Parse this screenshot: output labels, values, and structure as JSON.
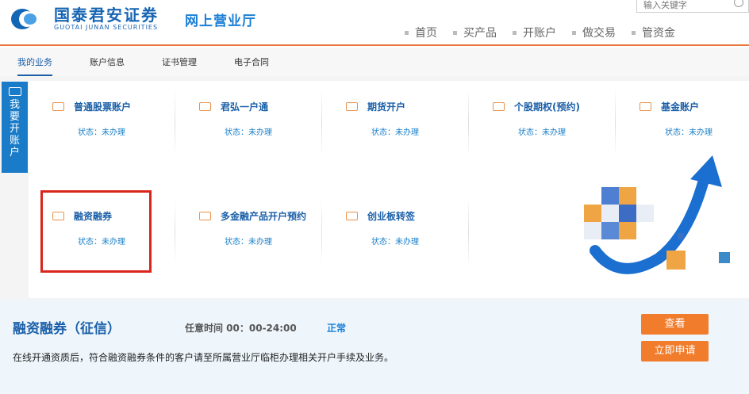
{
  "brand": {
    "name_cn": "国泰君安证券",
    "name_en": "GUOTAI JUNAN SECURITIES",
    "hall": "网上营业厅"
  },
  "search": {
    "placeholder": "输入关键字"
  },
  "topnav": [
    {
      "label": "首页"
    },
    {
      "label": "买产品"
    },
    {
      "label": "开账户"
    },
    {
      "label": "做交易"
    },
    {
      "label": "管资金"
    }
  ],
  "subnav": [
    {
      "label": "我的业务",
      "active": true
    },
    {
      "label": "账户信息",
      "active": false
    },
    {
      "label": "证书管理",
      "active": false
    },
    {
      "label": "电子合同",
      "active": false
    }
  ],
  "side_tab": {
    "label": "我要开账户"
  },
  "accounts": [
    {
      "title": "普通股票账户",
      "status": "状态：未办理",
      "icon": "card-icon"
    },
    {
      "title": "君弘一户通",
      "status": "状态：未办理",
      "icon": "edit-icon"
    },
    {
      "title": "期货开户",
      "status": "状态：未办理",
      "icon": "computer-icon"
    },
    {
      "title": "个股期权(预约)",
      "status": "状态：未办理",
      "icon": "chart-icon"
    },
    {
      "title": "基金账户",
      "status": "状态：未办理",
      "icon": "folder-icon"
    },
    {
      "title": "融资融券",
      "status": "状态：未办理",
      "icon": "card-icon"
    },
    {
      "title": "多金融产品开户预约",
      "status": "状态：未办理",
      "icon": "card-icon"
    },
    {
      "title": "创业板转签",
      "status": "状态：未办理",
      "icon": "briefcase-icon"
    }
  ],
  "detail": {
    "title": "融资融券（征信）",
    "time": "任意时间 00：00-24:00",
    "state": "正常",
    "description": "在线开通资质后，符合融资融券条件的客户请至所属营业厅临柜办理相关开户手续及业务。",
    "view_button": "查看",
    "apply_button": "立即申请"
  },
  "colors": {
    "brand_blue": "#1665b3",
    "accent_orange": "#f07c2c",
    "highlight_red": "#d9261c"
  }
}
